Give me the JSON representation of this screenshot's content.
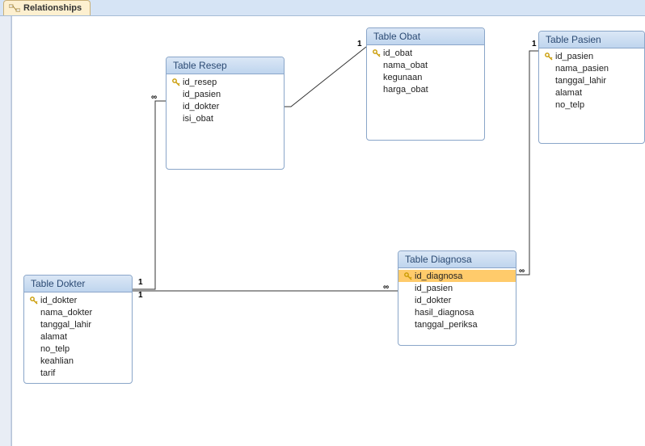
{
  "tab": {
    "label": "Relationships"
  },
  "tables": {
    "dokter": {
      "title": "Table Dokter",
      "fields": [
        {
          "name": "id_dokter",
          "pk": true
        },
        {
          "name": "nama_dokter",
          "pk": false
        },
        {
          "name": "tanggal_lahir",
          "pk": false
        },
        {
          "name": "alamat",
          "pk": false
        },
        {
          "name": "no_telp",
          "pk": false
        },
        {
          "name": "keahlian",
          "pk": false
        },
        {
          "name": "tarif",
          "pk": false
        }
      ]
    },
    "resep": {
      "title": "Table Resep",
      "fields": [
        {
          "name": "id_resep",
          "pk": true
        },
        {
          "name": "id_pasien",
          "pk": false
        },
        {
          "name": "id_dokter",
          "pk": false
        },
        {
          "name": "isi_obat",
          "pk": false
        }
      ]
    },
    "obat": {
      "title": "Table Obat",
      "fields": [
        {
          "name": "id_obat",
          "pk": true
        },
        {
          "name": "nama_obat",
          "pk": false
        },
        {
          "name": "kegunaan",
          "pk": false
        },
        {
          "name": "harga_obat",
          "pk": false
        }
      ]
    },
    "diagnosa": {
      "title": "Table Diagnosa",
      "fields": [
        {
          "name": "id_diagnosa",
          "pk": true,
          "selected": true
        },
        {
          "name": "id_pasien",
          "pk": false
        },
        {
          "name": "id_dokter",
          "pk": false
        },
        {
          "name": "hasil_diagnosa",
          "pk": false
        },
        {
          "name": "tanggal_periksa",
          "pk": false
        }
      ]
    },
    "pasien": {
      "title": "Table Pasien",
      "fields": [
        {
          "name": "id_pasien",
          "pk": true
        },
        {
          "name": "nama_pasien",
          "pk": false
        },
        {
          "name": "tanggal_lahir",
          "pk": false
        },
        {
          "name": "alamat",
          "pk": false
        },
        {
          "name": "no_telp",
          "pk": false
        }
      ]
    }
  },
  "relationships": [
    {
      "from": "dokter",
      "to": "resep",
      "from_label": "1",
      "to_label": "∞"
    },
    {
      "from": "dokter",
      "to": "diagnosa",
      "from_label": "1",
      "to_label": "∞"
    },
    {
      "from": "obat",
      "to": "resep",
      "from_label": "1",
      "to_label": "∞"
    },
    {
      "from": "pasien",
      "to": "diagnosa",
      "from_label": "1",
      "to_label": "∞"
    }
  ],
  "labels": {
    "one_a": "1",
    "inf_a": "∞",
    "one_b": "1",
    "inf_b": "∞",
    "one_c": "1",
    "inf_c": "∞",
    "one_d": "1",
    "inf_d": "∞"
  }
}
